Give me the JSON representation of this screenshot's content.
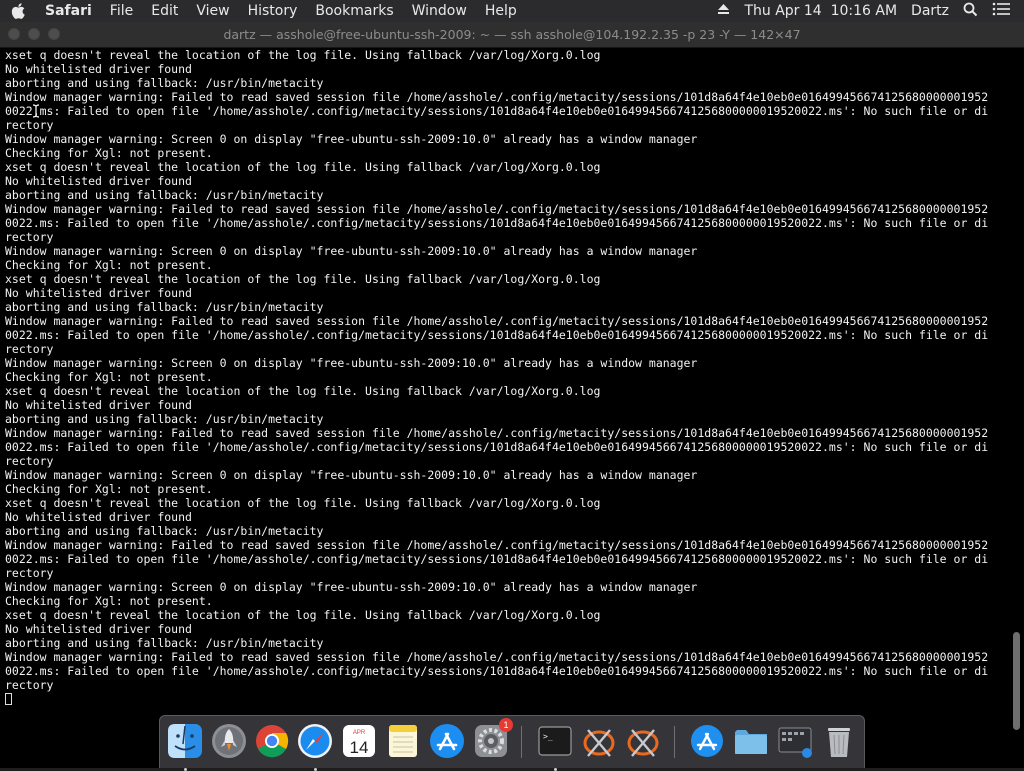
{
  "menubar": {
    "app_name": "Safari",
    "items": [
      "File",
      "Edit",
      "View",
      "History",
      "Bookmarks",
      "Window",
      "Help"
    ],
    "clock": "Thu Apr 14  10:16 AM",
    "user": "Dartz"
  },
  "window": {
    "title": "dartz — asshole@free-ubuntu-ssh-2009: ~ — ssh asshole@104.192.2.35 -p 23 -Y — 142×47"
  },
  "terminal": {
    "lines": [
      "xset q doesn't reveal the location of the log file. Using fallback /var/log/Xorg.0.log",
      "No whitelisted driver found",
      "aborting and using fallback: /usr/bin/metacity",
      "Window manager warning: Failed to read saved session file /home/asshole/.config/metacity/sessions/101d8a64f4e10eb0e016499456674125680000001952",
      "0022.ms: Failed to open file '/home/asshole/.config/metacity/sessions/101d8a64f4e10eb0e0164994566741256800000019520022.ms': No such file or di",
      "rectory",
      "Window manager warning: Screen 0 on display \"free-ubuntu-ssh-2009:10.0\" already has a window manager",
      "Checking for Xgl: not present.",
      "xset q doesn't reveal the location of the log file. Using fallback /var/log/Xorg.0.log",
      "No whitelisted driver found",
      "aborting and using fallback: /usr/bin/metacity",
      "Window manager warning: Failed to read saved session file /home/asshole/.config/metacity/sessions/101d8a64f4e10eb0e016499456674125680000001952",
      "0022.ms: Failed to open file '/home/asshole/.config/metacity/sessions/101d8a64f4e10eb0e0164994566741256800000019520022.ms': No such file or di",
      "rectory",
      "Window manager warning: Screen 0 on display \"free-ubuntu-ssh-2009:10.0\" already has a window manager",
      "Checking for Xgl: not present.",
      "xset q doesn't reveal the location of the log file. Using fallback /var/log/Xorg.0.log",
      "No whitelisted driver found",
      "aborting and using fallback: /usr/bin/metacity",
      "Window manager warning: Failed to read saved session file /home/asshole/.config/metacity/sessions/101d8a64f4e10eb0e016499456674125680000001952",
      "0022.ms: Failed to open file '/home/asshole/.config/metacity/sessions/101d8a64f4e10eb0e0164994566741256800000019520022.ms': No such file or di",
      "rectory",
      "Window manager warning: Screen 0 on display \"free-ubuntu-ssh-2009:10.0\" already has a window manager",
      "Checking for Xgl: not present.",
      "xset q doesn't reveal the location of the log file. Using fallback /var/log/Xorg.0.log",
      "No whitelisted driver found",
      "aborting and using fallback: /usr/bin/metacity",
      "Window manager warning: Failed to read saved session file /home/asshole/.config/metacity/sessions/101d8a64f4e10eb0e016499456674125680000001952",
      "0022.ms: Failed to open file '/home/asshole/.config/metacity/sessions/101d8a64f4e10eb0e0164994566741256800000019520022.ms': No such file or di",
      "rectory",
      "Window manager warning: Screen 0 on display \"free-ubuntu-ssh-2009:10.0\" already has a window manager",
      "Checking for Xgl: not present.",
      "xset q doesn't reveal the location of the log file. Using fallback /var/log/Xorg.0.log",
      "No whitelisted driver found",
      "aborting and using fallback: /usr/bin/metacity",
      "Window manager warning: Failed to read saved session file /home/asshole/.config/metacity/sessions/101d8a64f4e10eb0e016499456674125680000001952",
      "0022.ms: Failed to open file '/home/asshole/.config/metacity/sessions/101d8a64f4e10eb0e0164994566741256800000019520022.ms': No such file or di",
      "rectory",
      "Window manager warning: Screen 0 on display \"free-ubuntu-ssh-2009:10.0\" already has a window manager",
      "Checking for Xgl: not present.",
      "xset q doesn't reveal the location of the log file. Using fallback /var/log/Xorg.0.log",
      "No whitelisted driver found",
      "aborting and using fallback: /usr/bin/metacity",
      "Window manager warning: Failed to read saved session file /home/asshole/.config/metacity/sessions/101d8a64f4e10eb0e016499456674125680000001952",
      "0022.ms: Failed to open file '/home/asshole/.config/metacity/sessions/101d8a64f4e10eb0e0164994566741256800000019520022.ms': No such file or di",
      "rectory"
    ]
  },
  "dock": {
    "items": [
      {
        "icon": "finder-icon",
        "running": true
      },
      {
        "icon": "launchpad-icon",
        "running": false
      },
      {
        "icon": "chrome-icon",
        "running": false
      },
      {
        "icon": "safari-icon",
        "running": true
      },
      {
        "icon": "calendar-icon",
        "running": false,
        "month": "APR",
        "day": "14"
      },
      {
        "icon": "notes-icon",
        "running": false
      },
      {
        "icon": "app-store-icon",
        "running": false
      },
      {
        "icon": "system-preferences-icon",
        "running": false,
        "badge": "1"
      },
      {
        "icon": "terminal-icon",
        "running": true,
        "prompt": ">_"
      },
      {
        "icon": "xcode-icon-1",
        "running": false
      },
      {
        "icon": "xcode-icon-2",
        "running": false
      },
      {
        "icon": "app-store-folder-icon",
        "running": false
      },
      {
        "icon": "folder-icon",
        "running": false
      },
      {
        "icon": "screenshots-icon",
        "running": false
      },
      {
        "icon": "trash-icon",
        "running": false
      }
    ]
  },
  "colors": {
    "terminal_bg": "#000000",
    "terminal_fg": "#f2f2f2",
    "menubar_bg": "#2b2b2d",
    "titlebar_bg": "#2f2f2f",
    "badge_red": "#e63a32"
  }
}
